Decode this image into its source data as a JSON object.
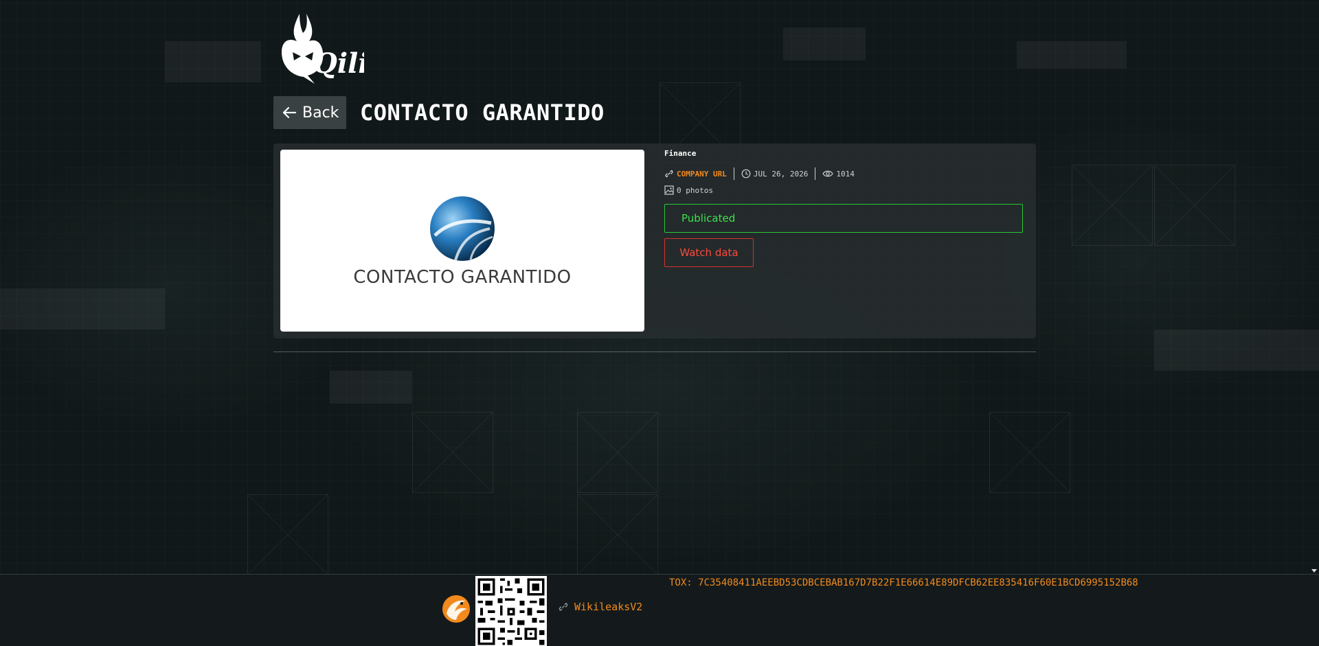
{
  "header": {
    "logo_text": "Qilin"
  },
  "nav": {
    "back_label": "Back"
  },
  "page": {
    "title": "CONTACTO GARANTIDO"
  },
  "card": {
    "image_caption": "CONTACTO GARANTIDO",
    "category": "Finance",
    "company_url_label": "COMPANY URL",
    "date": "JUL 26, 2026",
    "views": "1014",
    "photos": "0 photos",
    "status": "Publicated",
    "watch_label": "Watch data"
  },
  "footer": {
    "link_label": "WikileaksV2",
    "tox": "TOX: 7C35408411AEEBD53CDBCEBAB167D7B22F1E66614E89DFCB62EE835416F60E1BCD6995152B68"
  },
  "colors": {
    "accent_orange": "#f28a1d",
    "status_green": "#3fe04f",
    "danger_red": "#ff4a3d",
    "background": "#111819"
  },
  "icons": [
    "arrow-left-icon",
    "link-icon",
    "clock-icon",
    "eye-icon",
    "image-icon",
    "phoenix-icon",
    "qr-code"
  ]
}
